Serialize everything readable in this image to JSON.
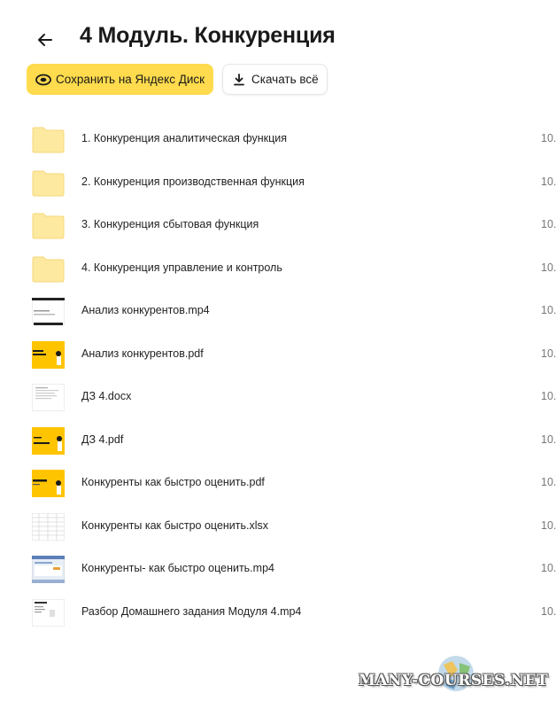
{
  "header": {
    "title": "4 Модуль. Конкуренция",
    "save_label": "Сохранить на Яндекс Диск",
    "download_label": "Скачать всё"
  },
  "items": [
    {
      "name": "1. Конкуренция аналитическая функция",
      "date": "10.",
      "type": "folder"
    },
    {
      "name": "2. Конкуренция производственная функция",
      "date": "10.",
      "type": "folder"
    },
    {
      "name": "3. Конкуренция сбытовая функция",
      "date": "10.",
      "type": "folder"
    },
    {
      "name": "4. Конкуренция управление и контроль",
      "date": "10.",
      "type": "folder"
    },
    {
      "name": "Анализ конкурентов.mp4",
      "date": "10.",
      "type": "video"
    },
    {
      "name": "Анализ конкурентов.pdf",
      "date": "10.",
      "type": "pdf"
    },
    {
      "name": "ДЗ 4.docx",
      "date": "10.",
      "type": "docx"
    },
    {
      "name": "ДЗ 4.pdf",
      "date": "10.",
      "type": "pdf"
    },
    {
      "name": "Конкуренты как быстро оценить.pdf",
      "date": "10.",
      "type": "pdf"
    },
    {
      "name": "Конкуренты как быстро оценить.xlsx",
      "date": "10.",
      "type": "xlsx"
    },
    {
      "name": "Конкуренты- как быстро оценить.mp4",
      "date": "10.",
      "type": "video-screen"
    },
    {
      "name": "Разбор Домашнего задания Модуля 4.mp4",
      "date": "10.",
      "type": "video-slide"
    }
  ],
  "watermark": "MANY-COURSES.NET",
  "colors": {
    "accent": "#ffdb4d",
    "folder": "#fde9a0",
    "folder_edge": "#f6d77a",
    "slide": "#ffc400"
  }
}
